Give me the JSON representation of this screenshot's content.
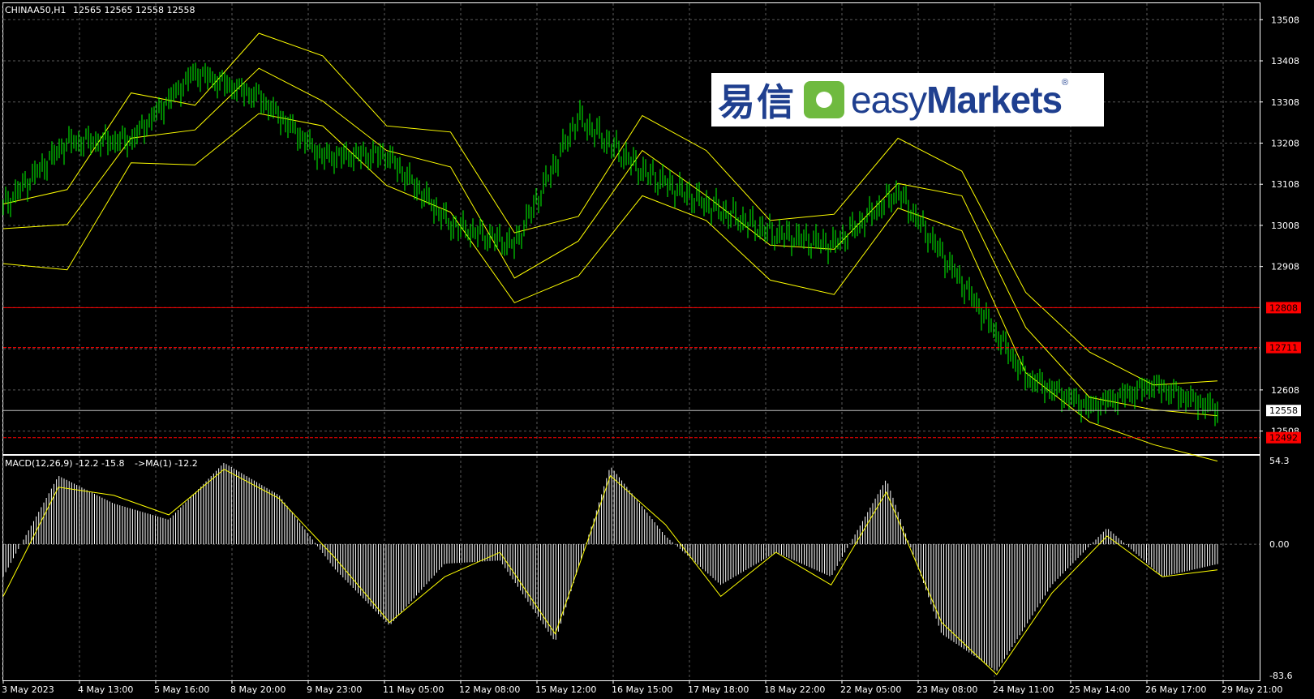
{
  "header": {
    "symbol": "CHINAA50,H1",
    "ohlc": "12565 12565 12558 12558"
  },
  "indicator": {
    "label": "MACD(12,26,9) -12.2 -15.8",
    "ma_label": "->MA(1) -12.2"
  },
  "logo": {
    "cn_text": "易信",
    "en_light": "easy",
    "en_bold": "Markets",
    "mark": "®",
    "icon": "easymarkets-square-icon"
  },
  "colors": {
    "background": "#000000",
    "candle": "#00ff00",
    "bands": "#ffff00",
    "level_line": "#ff0000",
    "bid_line": "#c0c0c0",
    "grid": "#5a5a5a",
    "macd_hist": "#ffffff",
    "macd_signal": "#ffff00"
  },
  "chart_data": [
    {
      "type": "line",
      "title": "CHINAA50,H1",
      "xlabel": "",
      "ylabel": "",
      "ylim": [
        12452,
        13548
      ],
      "grid": true,
      "y_ticks": [
        13508,
        13408,
        13308,
        13208,
        13108,
        13008,
        12908,
        12608,
        12508
      ],
      "x_ticks": [
        "3 May 2023",
        "4 May 13:00",
        "5 May 16:00",
        "8 May 20:00",
        "9 May 23:00",
        "11 May 05:00",
        "12 May 08:00",
        "15 May 12:00",
        "16 May 15:00",
        "17 May 18:00",
        "18 May 22:00",
        "22 May 05:00",
        "23 May 08:00",
        "24 May 11:00",
        "25 May 14:00",
        "26 May 17:00",
        "29 May 21:00"
      ],
      "levels": [
        {
          "value": 12808,
          "label": "12808",
          "style": "solid"
        },
        {
          "value": 12711,
          "label": "12711",
          "style": "dashed"
        },
        {
          "value": 12492,
          "label": "12492",
          "style": "dashed"
        }
      ],
      "bid": {
        "value": 12558,
        "label": "12558"
      },
      "x": [
        0,
        3,
        6,
        9,
        12,
        15,
        18,
        21,
        24,
        27,
        30,
        33,
        36,
        39,
        42,
        45,
        48
      ],
      "series": [
        {
          "values": [
            13055,
            13210,
            13215,
            13380,
            13320,
            13175,
            13180,
            13010,
            12960,
            13270,
            13140,
            13060,
            12990,
            12960,
            13090,
            12870,
            12640,
            12565,
            12620,
            12560
          ]
        },
        {
          "values": [
            13000,
            13010,
            13220,
            13240,
            13390,
            13310,
            13190,
            13150,
            12880,
            12970,
            13190,
            13080,
            12960,
            12950,
            13110,
            13080,
            12760,
            12590,
            12560,
            12545
          ]
        }
      ]
    },
    {
      "type": "bar",
      "title": "MACD(12,26,9) -12.2 -15.8",
      "ylim": [
        -83.6,
        54.3
      ],
      "y_ticks": [
        54.3,
        0.0,
        -83.6
      ],
      "series": [
        {
          "values": [
            -20,
            42,
            25,
            15,
            50,
            30,
            -15,
            -50,
            -12,
            -10,
            -60,
            48,
            5,
            -25,
            -5,
            -20,
            40,
            -55,
            -78,
            -25,
            10,
            -20,
            -12.2
          ]
        },
        {
          "values": [
            -32,
            35,
            30,
            18,
            46,
            28,
            -8,
            -48,
            -20,
            -5,
            -55,
            42,
            12,
            -32,
            -5,
            -25,
            32,
            -48,
            -80,
            -30,
            5,
            -20,
            -15.8
          ]
        }
      ]
    }
  ]
}
